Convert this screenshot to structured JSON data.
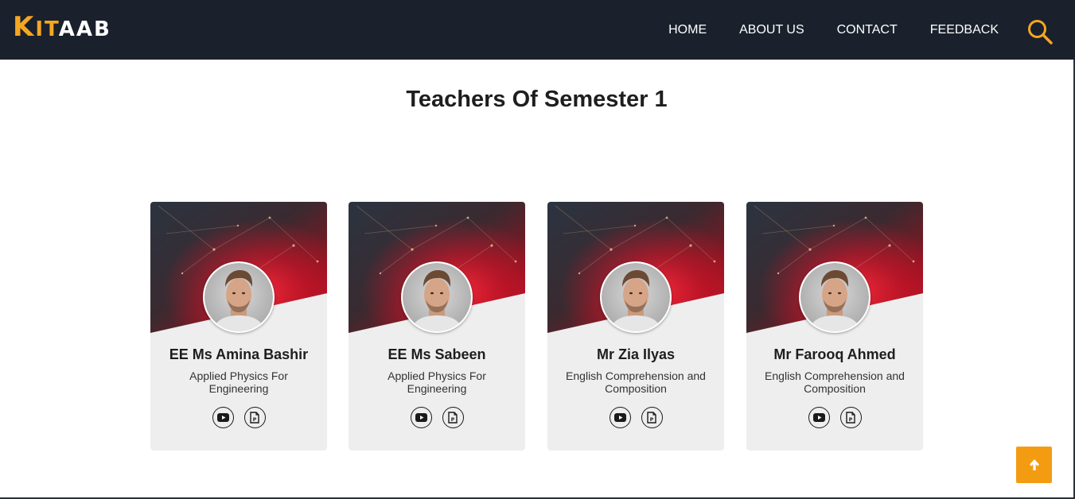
{
  "brand": {
    "logo_parts": [
      "K",
      "IT",
      "A",
      "AB"
    ],
    "accent_color": "#f5a623",
    "nav_bg": "#1a212c"
  },
  "nav": {
    "items": [
      {
        "label": "HOME"
      },
      {
        "label": "ABOUT US"
      },
      {
        "label": "CONTACT"
      },
      {
        "label": "FEEDBACK"
      }
    ],
    "search_icon": "search-icon"
  },
  "page": {
    "title": "Teachers Of Semester 1"
  },
  "teachers": [
    {
      "name": "EE Ms Amina Bashir",
      "subject": "Applied Physics For Engineering",
      "icons": [
        "youtube-icon",
        "pdf-file-icon"
      ]
    },
    {
      "name": "EE Ms Sabeen",
      "subject": "Applied Physics For Engineering",
      "icons": [
        "youtube-icon",
        "pdf-file-icon"
      ]
    },
    {
      "name": "Mr Zia Ilyas",
      "subject": "English Comprehension and Composition",
      "icons": [
        "youtube-icon",
        "pdf-file-icon"
      ]
    },
    {
      "name": "Mr Farooq Ahmed",
      "subject": "English Comprehension and Composition",
      "icons": [
        "youtube-icon",
        "pdf-file-icon"
      ]
    }
  ],
  "scroll_top": {
    "icon": "arrow-up-icon",
    "color": "#f39c12"
  }
}
